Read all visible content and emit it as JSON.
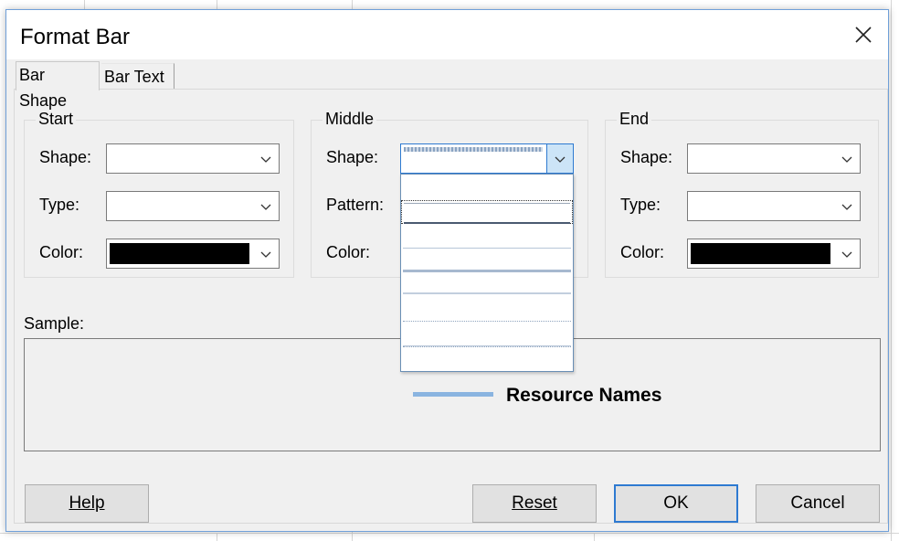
{
  "dialog": {
    "title": "Format Bar",
    "close_glyph": "✕"
  },
  "tabs": [
    {
      "label": "Bar Shape",
      "active": true
    },
    {
      "label": "Bar Text",
      "active": false
    }
  ],
  "groups": {
    "start": {
      "title": "Start",
      "shape_label": "Shape:",
      "type_label": "Type:",
      "color_label": "Color:",
      "color_value": "#000000"
    },
    "middle": {
      "title": "Middle",
      "shape_label": "Shape:",
      "pattern_label": "Pattern:",
      "color_label": "Color:"
    },
    "end": {
      "title": "End",
      "shape_label": "Shape:",
      "type_label": "Type:",
      "color_label": "Color:",
      "color_value": "#000000"
    }
  },
  "sample": {
    "label": "Sample:",
    "text": "Resource Names",
    "bar_color": "#8ab4e0"
  },
  "buttons": {
    "help": "Help",
    "reset": "Reset",
    "ok": "OK",
    "cancel": "Cancel"
  },
  "icons": {
    "dropdown": "chevron-down-icon",
    "close": "close-icon"
  }
}
